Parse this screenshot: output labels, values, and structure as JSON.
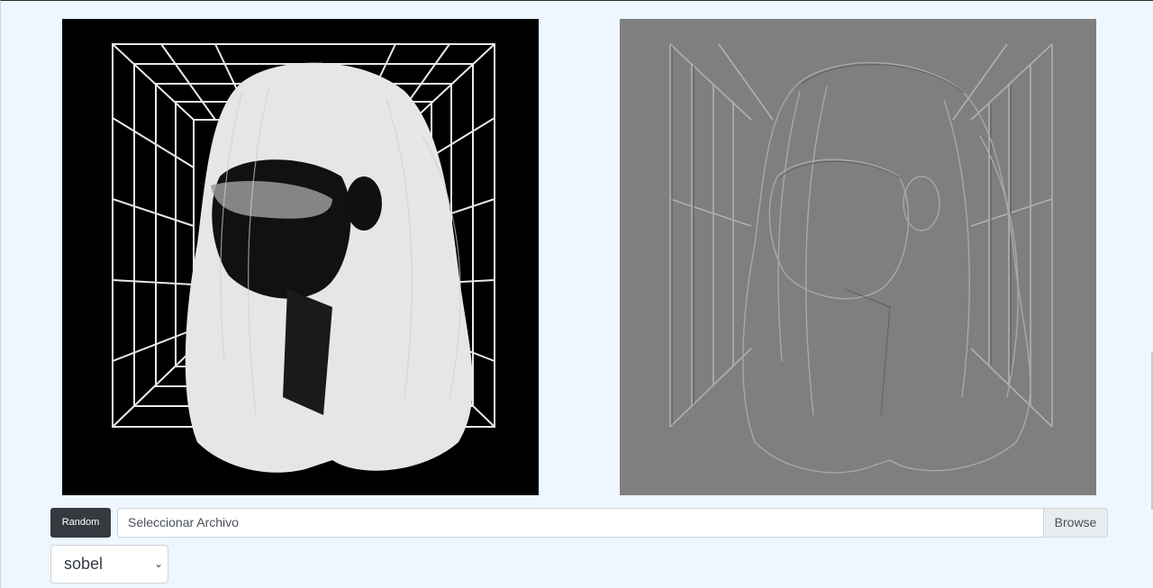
{
  "images": {
    "original": {
      "icon": "portrait-image",
      "description_color": "#000000"
    },
    "filtered": {
      "icon": "embossed-portrait-image",
      "description_color": "#7f7f7f"
    }
  },
  "controls": {
    "random_label": "Random",
    "file_label": "Seleccionar Archivo",
    "browse_label": "Browse",
    "filter_selected": "sobel"
  },
  "colors": {
    "background": "#eef6ff",
    "random_button": "#343a40",
    "browse_bg": "#e9ecef"
  }
}
